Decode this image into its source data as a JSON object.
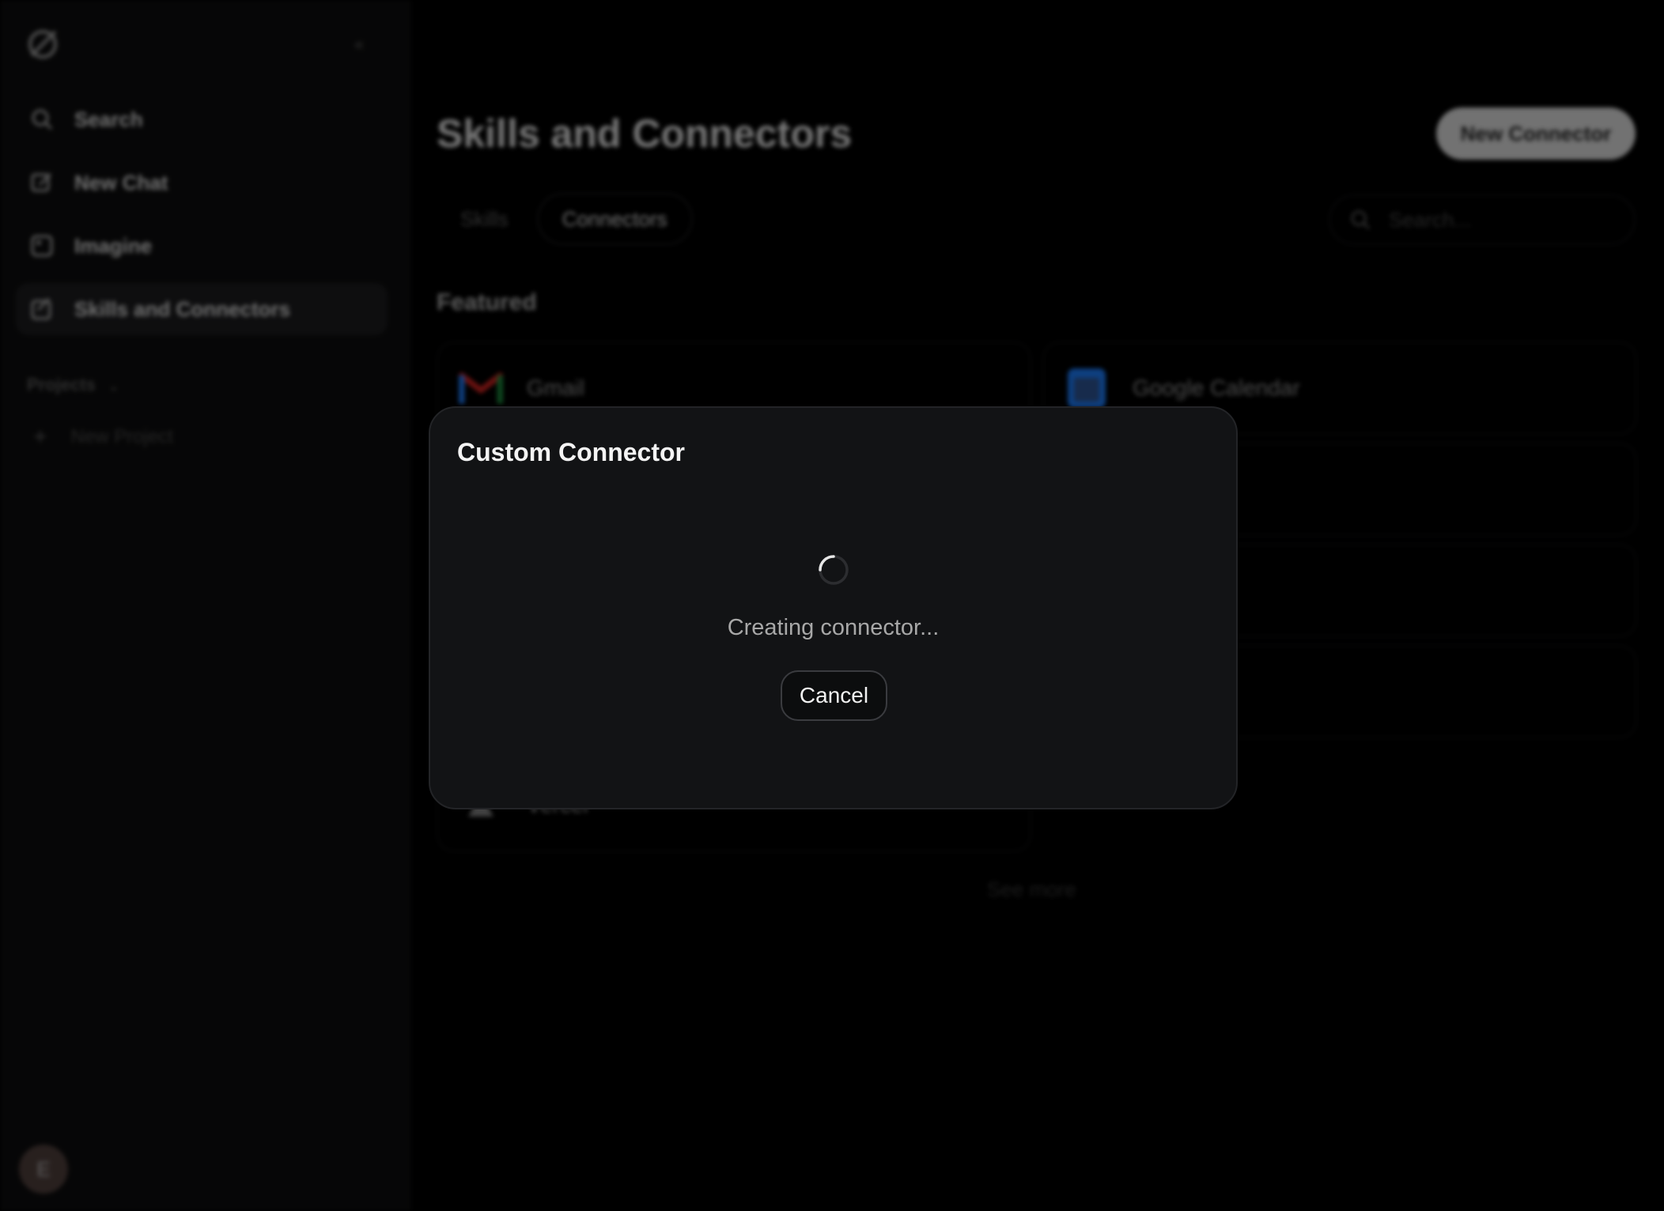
{
  "sidebar": {
    "logo_icon": "xai-logo-icon",
    "collapse_icon": "collapse-sidebar-icon",
    "items": [
      {
        "label": "Search",
        "icon": "search-icon"
      },
      {
        "label": "New Chat",
        "icon": "edit-icon"
      },
      {
        "label": "Imagine",
        "icon": "image-icon"
      },
      {
        "label": "Skills and Connectors",
        "icon": "skills-icon",
        "active": true
      }
    ],
    "projects_label": "Projects",
    "new_project_label": "New Project",
    "avatar_initial": "E"
  },
  "main": {
    "title": "Skills and Connectors",
    "new_connector_label": "New Connector",
    "tabs": [
      {
        "label": "Skills",
        "active": false
      },
      {
        "label": "Connectors",
        "active": true
      }
    ],
    "search_placeholder": "Search...",
    "featured_label": "Featured",
    "cards": [
      {
        "label": "Gmail",
        "icon": "gmail-icon"
      },
      {
        "label": "Google Calendar",
        "icon": "google-calendar-icon"
      },
      {
        "label": "Vercel",
        "icon": "vercel-icon"
      }
    ],
    "see_more_label": "See more"
  },
  "modal": {
    "title": "Custom Connector",
    "status": "Creating connector...",
    "cancel_label": "Cancel"
  },
  "colors": {
    "background": "#000000",
    "sidebar": "#0c0c0d",
    "modal_bg": "#121315",
    "modal_border": "#232427",
    "status_text": "#a8a8a8"
  }
}
